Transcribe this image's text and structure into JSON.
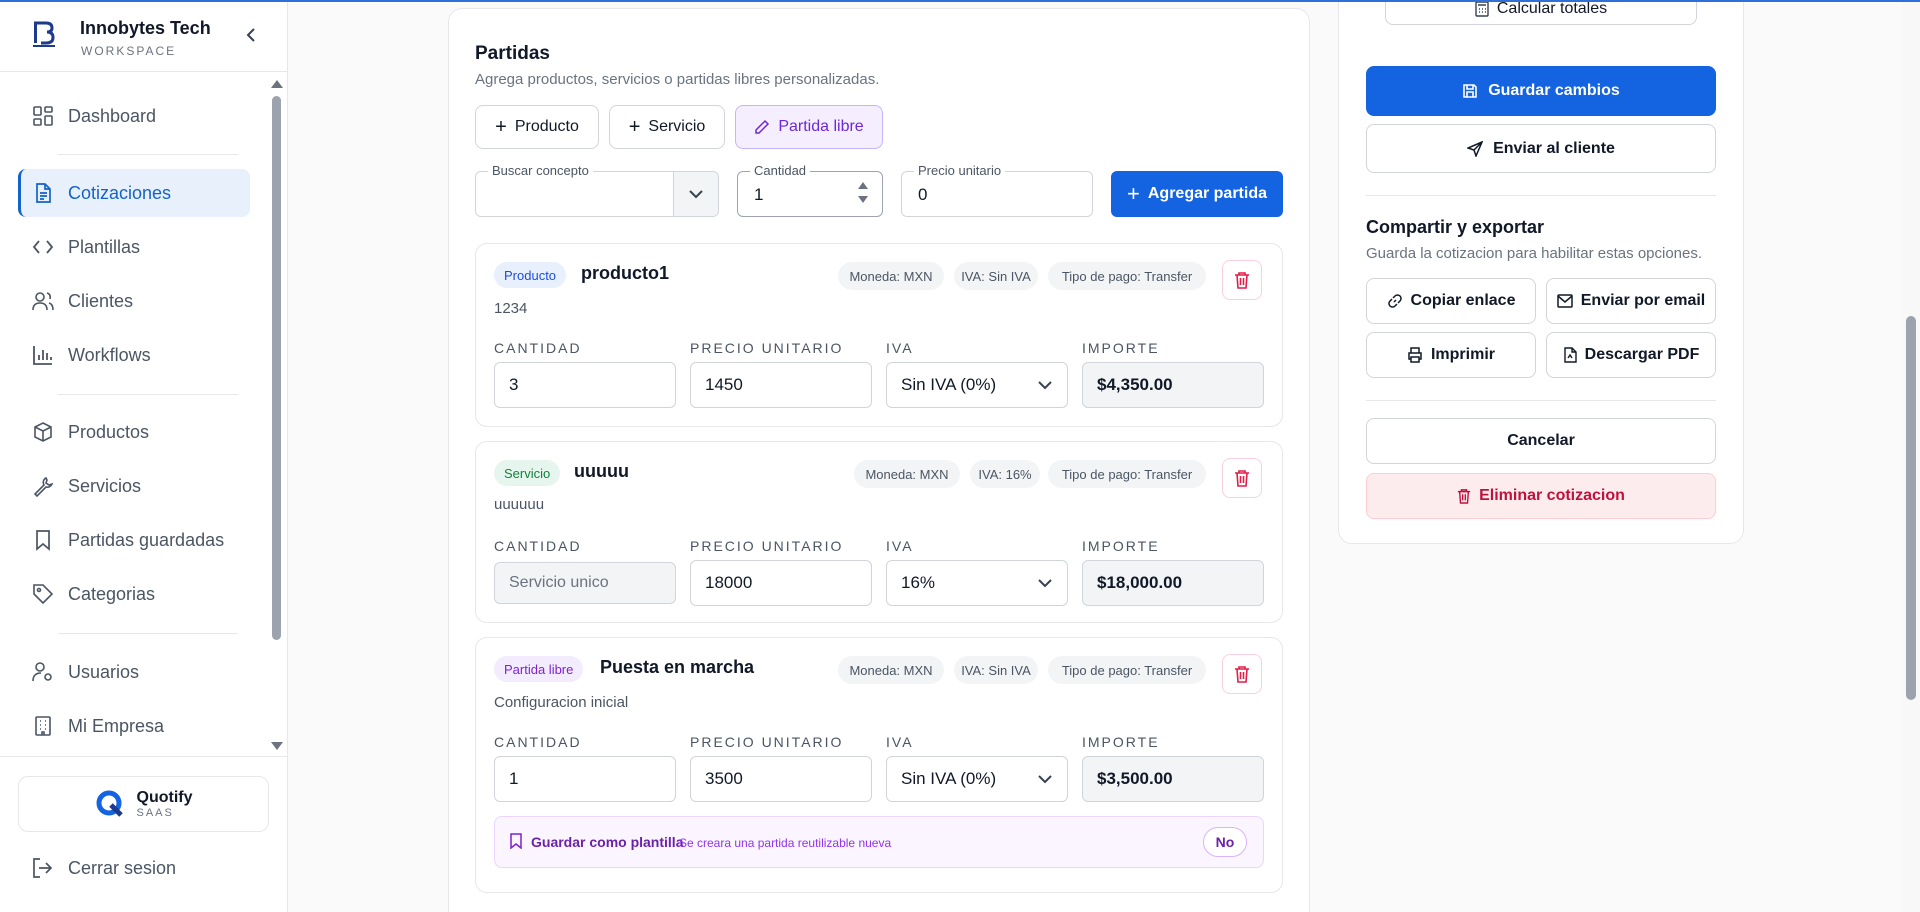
{
  "brand": {
    "name": "Innobytes Tech",
    "subtitle": "WORKSPACE"
  },
  "nav": {
    "items": [
      {
        "label": "Dashboard",
        "icon": "grid-icon"
      },
      {
        "label": "Cotizaciones",
        "icon": "document-icon",
        "active": true
      },
      {
        "label": "Plantillas",
        "icon": "code-icon"
      },
      {
        "label": "Clientes",
        "icon": "users-icon"
      },
      {
        "label": "Workflows",
        "icon": "bar-chart-icon"
      },
      {
        "label": "Productos",
        "icon": "box-icon"
      },
      {
        "label": "Servicios",
        "icon": "wrench-icon"
      },
      {
        "label": "Partidas guardadas",
        "icon": "bookmark-icon"
      },
      {
        "label": "Categorias",
        "icon": "tag-icon"
      },
      {
        "label": "Usuarios",
        "icon": "user-settings-icon"
      },
      {
        "label": "Mi Empresa",
        "icon": "building-icon"
      }
    ]
  },
  "app": {
    "name": "Quotify",
    "sub": "SAAS"
  },
  "logout": "Cerrar sesion",
  "partidas": {
    "title": "Partidas",
    "description": "Agrega productos, servicios o partidas libres personalizadas.",
    "types": [
      "Producto",
      "Servicio",
      "Partida libre"
    ],
    "search": {
      "label": "Buscar concepto",
      "value": ""
    },
    "quantity": {
      "label": "Cantidad",
      "value": "1"
    },
    "unit_price": {
      "label": "Precio unitario",
      "value": "0"
    },
    "add_label": "Agregar partida",
    "columns": [
      "CANTIDAD",
      "PRECIO UNITARIO",
      "IVA",
      "IMPORTE"
    ],
    "items": [
      {
        "badge": "Producto",
        "name": "producto1",
        "description": "1234",
        "chips": [
          "Moneda: MXN",
          "IVA: Sin IVA",
          "Tipo de pago: Transfer"
        ],
        "quantity": "3",
        "price": "1450",
        "iva": "Sin IVA (0%)",
        "amount": "$4,350.00"
      },
      {
        "badge": "Servicio",
        "name": "uuuuu",
        "description": "uuuuuu",
        "chips": [
          "Moneda: MXN",
          "IVA: 16%",
          "Tipo de pago: Transfer"
        ],
        "quantity": "Servicio unico",
        "price": "18000",
        "iva": "16%",
        "amount": "$18,000.00"
      },
      {
        "badge": "Partida libre",
        "name": "Puesta en marcha",
        "description": "Configuracion inicial",
        "chips": [
          "Moneda: MXN",
          "IVA: Sin IVA",
          "Tipo de pago: Transfer"
        ],
        "quantity": "1",
        "price": "3500",
        "iva": "Sin IVA (0%)",
        "amount": "$3,500.00",
        "template": {
          "label": "Guardar como plantilla",
          "hint": "Se creara una partida reutilizable nueva",
          "toggle": "No"
        }
      }
    ]
  },
  "actions": {
    "calc": "Calcular totales",
    "save": "Guardar cambios",
    "send": "Enviar al cliente",
    "share_title": "Compartir y exportar",
    "share_desc": "Guarda la cotizacion para habilitar estas opciones.",
    "copy_link": "Copiar enlace",
    "email": "Enviar por email",
    "print": "Imprimir",
    "pdf": "Descargar PDF",
    "cancel": "Cancelar",
    "delete": "Eliminar cotizacion"
  },
  "colors": {
    "primary": "#1463e0",
    "active_nav": "#1463c9",
    "danger": "#be123c",
    "purple": "#6d28d9"
  }
}
